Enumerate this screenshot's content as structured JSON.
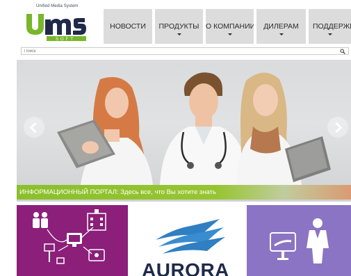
{
  "brand": {
    "tagline": "Unified Media System",
    "logo_text": "UMS",
    "logo_sub": "SOFT",
    "colors": {
      "green": "#78b62b",
      "navy": "#1f2a4a"
    }
  },
  "nav": {
    "items": [
      {
        "label": "НОВОСТИ",
        "has_dropdown": false
      },
      {
        "label": "ПРОДУКТЫ",
        "has_dropdown": true
      },
      {
        "label": "О КОМПАНИИ",
        "has_dropdown": true
      },
      {
        "label": "ДИЛЕРАМ",
        "has_dropdown": true
      },
      {
        "label": "ПОДДЕРЖКА",
        "has_dropdown": true
      }
    ]
  },
  "search": {
    "placeholder": "Поиск",
    "value": ""
  },
  "hero": {
    "caption": "ИНФОРМАЦИОННЫЙ ПОРТАЛ: Здесь все, что Вы хотите знать",
    "caption_color": "#8bbf2c",
    "left_arrow_icon": "chevron-left-icon",
    "right_arrow_icon": "chevron-right-icon"
  },
  "tiles": [
    {
      "name": "purple-tile",
      "color": "#8b1f7a",
      "icons": [
        "people-icon",
        "hospital-icon",
        "monitor-icon",
        "kiosk-icon"
      ]
    },
    {
      "name": "aurora-tile",
      "text": "AURORA",
      "color": "#ffffff"
    },
    {
      "name": "violet-tile",
      "color": "#8b74c4",
      "icons": [
        "monitor-icon",
        "person-icon"
      ]
    }
  ]
}
